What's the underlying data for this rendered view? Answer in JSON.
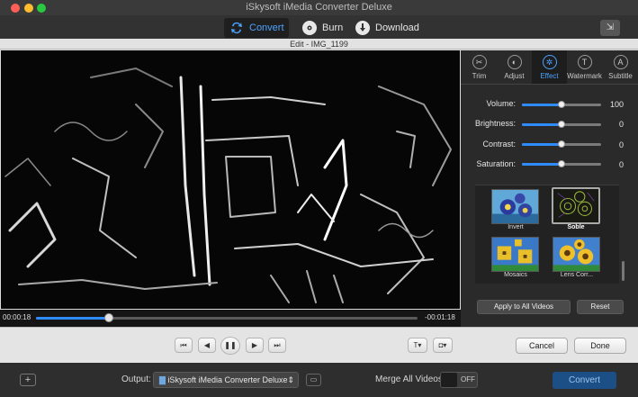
{
  "window": {
    "title": "iSkysoft iMedia Converter Deluxe"
  },
  "traffic_lights": {
    "close": "#ff5f57",
    "minimize": "#febc2e",
    "zoom": "#28c840"
  },
  "toolbar": {
    "tabs": [
      {
        "label": "Convert",
        "icon": "convert-icon",
        "active": true
      },
      {
        "label": "Burn",
        "icon": "disc-icon",
        "active": false
      },
      {
        "label": "Download",
        "icon": "download-icon",
        "active": false
      }
    ],
    "accent": "#4da3ff"
  },
  "dialog": {
    "title": "Edit - IMG_1199"
  },
  "player": {
    "time_current": "00:00:18",
    "time_remaining": "-00:01:18",
    "progress": 0.19
  },
  "edit_tabs": [
    {
      "label": "Trim",
      "icon": "scissors-icon",
      "active": false
    },
    {
      "label": "Adjust",
      "icon": "adjust-icon",
      "active": false
    },
    {
      "label": "Effect",
      "icon": "effect-icon",
      "active": true
    },
    {
      "label": "Watermark",
      "icon": "watermark-icon",
      "active": false
    },
    {
      "label": "Subtitle",
      "icon": "subtitle-icon",
      "active": false
    }
  ],
  "adjust_sliders": [
    {
      "label": "Volume:",
      "value": "100",
      "level": 0.5
    },
    {
      "label": "Brightness:",
      "value": "0",
      "level": 0.5
    },
    {
      "label": "Contrast:",
      "value": "0",
      "level": 0.5
    },
    {
      "label": "Saturation:",
      "value": "0",
      "level": 0.5
    }
  ],
  "effects": [
    {
      "label": "Invert",
      "selected": false
    },
    {
      "label": "Soble",
      "selected": true
    },
    {
      "label": "Mosaics",
      "selected": false
    },
    {
      "label": "Lens Corr...",
      "selected": false
    }
  ],
  "panel_buttons": {
    "apply_all": "Apply to All Videos",
    "reset": "Reset"
  },
  "dialog_buttons": {
    "cancel": "Cancel",
    "done": "Done"
  },
  "bottom_bar": {
    "output_label": "Output:",
    "output_value": "iSkysoft iMedia Converter Deluxe",
    "merge_label": "Merge All Videos:",
    "merge_state": "OFF",
    "convert_label": "Convert"
  }
}
